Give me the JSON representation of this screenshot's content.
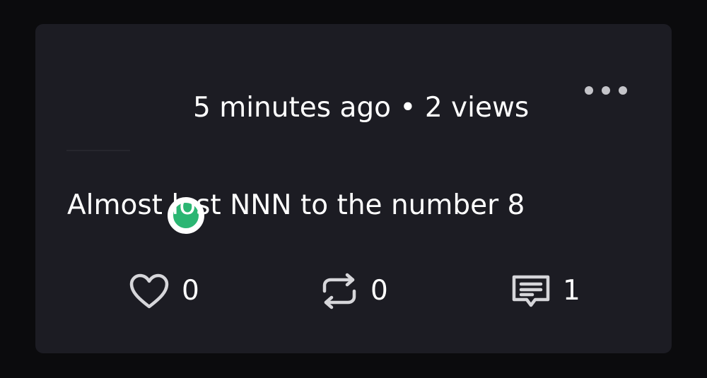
{
  "post": {
    "time_ago": "5 minutes ago",
    "separator": "•",
    "views": "2 views",
    "text": "Almost lost NNN to the number 8",
    "status_color": "#2bb673"
  },
  "actions": {
    "likes": "0",
    "reposts": "0",
    "comments": "1"
  },
  "icons": {
    "more": "more-horizontal-icon",
    "like": "heart-outline-icon",
    "repost": "repost-icon",
    "comment": "comment-icon"
  }
}
